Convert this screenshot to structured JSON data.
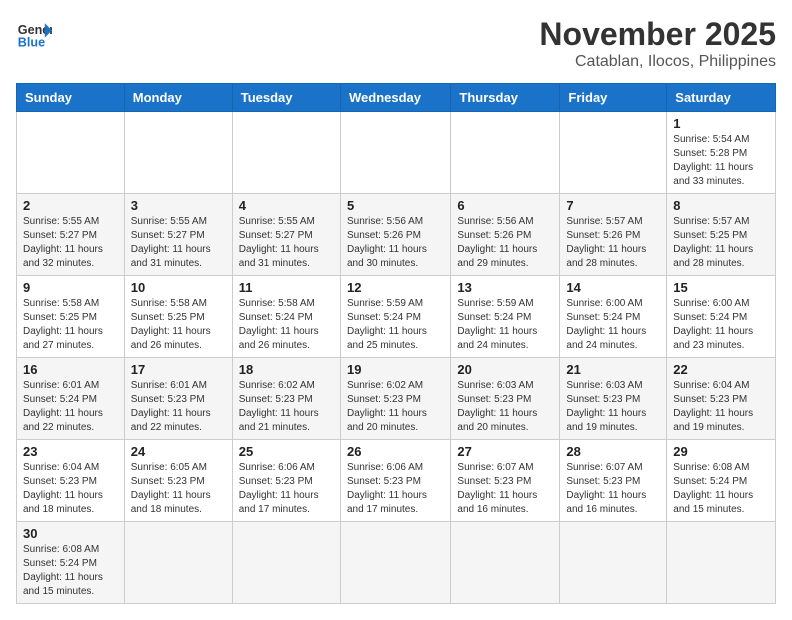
{
  "logo": {
    "text_general": "General",
    "text_blue": "Blue"
  },
  "header": {
    "month": "November 2025",
    "location": "Catablan, Ilocos, Philippines"
  },
  "weekdays": [
    "Sunday",
    "Monday",
    "Tuesday",
    "Wednesday",
    "Thursday",
    "Friday",
    "Saturday"
  ],
  "weeks": [
    [
      {
        "day": "",
        "sunrise": "",
        "sunset": "",
        "daylight": ""
      },
      {
        "day": "",
        "sunrise": "",
        "sunset": "",
        "daylight": ""
      },
      {
        "day": "",
        "sunrise": "",
        "sunset": "",
        "daylight": ""
      },
      {
        "day": "",
        "sunrise": "",
        "sunset": "",
        "daylight": ""
      },
      {
        "day": "",
        "sunrise": "",
        "sunset": "",
        "daylight": ""
      },
      {
        "day": "",
        "sunrise": "",
        "sunset": "",
        "daylight": ""
      },
      {
        "day": "1",
        "sunrise": "Sunrise: 5:54 AM",
        "sunset": "Sunset: 5:28 PM",
        "daylight": "Daylight: 11 hours and 33 minutes."
      }
    ],
    [
      {
        "day": "2",
        "sunrise": "Sunrise: 5:55 AM",
        "sunset": "Sunset: 5:27 PM",
        "daylight": "Daylight: 11 hours and 32 minutes."
      },
      {
        "day": "3",
        "sunrise": "Sunrise: 5:55 AM",
        "sunset": "Sunset: 5:27 PM",
        "daylight": "Daylight: 11 hours and 31 minutes."
      },
      {
        "day": "4",
        "sunrise": "Sunrise: 5:55 AM",
        "sunset": "Sunset: 5:27 PM",
        "daylight": "Daylight: 11 hours and 31 minutes."
      },
      {
        "day": "5",
        "sunrise": "Sunrise: 5:56 AM",
        "sunset": "Sunset: 5:26 PM",
        "daylight": "Daylight: 11 hours and 30 minutes."
      },
      {
        "day": "6",
        "sunrise": "Sunrise: 5:56 AM",
        "sunset": "Sunset: 5:26 PM",
        "daylight": "Daylight: 11 hours and 29 minutes."
      },
      {
        "day": "7",
        "sunrise": "Sunrise: 5:57 AM",
        "sunset": "Sunset: 5:26 PM",
        "daylight": "Daylight: 11 hours and 28 minutes."
      },
      {
        "day": "8",
        "sunrise": "Sunrise: 5:57 AM",
        "sunset": "Sunset: 5:25 PM",
        "daylight": "Daylight: 11 hours and 28 minutes."
      }
    ],
    [
      {
        "day": "9",
        "sunrise": "Sunrise: 5:58 AM",
        "sunset": "Sunset: 5:25 PM",
        "daylight": "Daylight: 11 hours and 27 minutes."
      },
      {
        "day": "10",
        "sunrise": "Sunrise: 5:58 AM",
        "sunset": "Sunset: 5:25 PM",
        "daylight": "Daylight: 11 hours and 26 minutes."
      },
      {
        "day": "11",
        "sunrise": "Sunrise: 5:58 AM",
        "sunset": "Sunset: 5:24 PM",
        "daylight": "Daylight: 11 hours and 26 minutes."
      },
      {
        "day": "12",
        "sunrise": "Sunrise: 5:59 AM",
        "sunset": "Sunset: 5:24 PM",
        "daylight": "Daylight: 11 hours and 25 minutes."
      },
      {
        "day": "13",
        "sunrise": "Sunrise: 5:59 AM",
        "sunset": "Sunset: 5:24 PM",
        "daylight": "Daylight: 11 hours and 24 minutes."
      },
      {
        "day": "14",
        "sunrise": "Sunrise: 6:00 AM",
        "sunset": "Sunset: 5:24 PM",
        "daylight": "Daylight: 11 hours and 24 minutes."
      },
      {
        "day": "15",
        "sunrise": "Sunrise: 6:00 AM",
        "sunset": "Sunset: 5:24 PM",
        "daylight": "Daylight: 11 hours and 23 minutes."
      }
    ],
    [
      {
        "day": "16",
        "sunrise": "Sunrise: 6:01 AM",
        "sunset": "Sunset: 5:24 PM",
        "daylight": "Daylight: 11 hours and 22 minutes."
      },
      {
        "day": "17",
        "sunrise": "Sunrise: 6:01 AM",
        "sunset": "Sunset: 5:23 PM",
        "daylight": "Daylight: 11 hours and 22 minutes."
      },
      {
        "day": "18",
        "sunrise": "Sunrise: 6:02 AM",
        "sunset": "Sunset: 5:23 PM",
        "daylight": "Daylight: 11 hours and 21 minutes."
      },
      {
        "day": "19",
        "sunrise": "Sunrise: 6:02 AM",
        "sunset": "Sunset: 5:23 PM",
        "daylight": "Daylight: 11 hours and 20 minutes."
      },
      {
        "day": "20",
        "sunrise": "Sunrise: 6:03 AM",
        "sunset": "Sunset: 5:23 PM",
        "daylight": "Daylight: 11 hours and 20 minutes."
      },
      {
        "day": "21",
        "sunrise": "Sunrise: 6:03 AM",
        "sunset": "Sunset: 5:23 PM",
        "daylight": "Daylight: 11 hours and 19 minutes."
      },
      {
        "day": "22",
        "sunrise": "Sunrise: 6:04 AM",
        "sunset": "Sunset: 5:23 PM",
        "daylight": "Daylight: 11 hours and 19 minutes."
      }
    ],
    [
      {
        "day": "23",
        "sunrise": "Sunrise: 6:04 AM",
        "sunset": "Sunset: 5:23 PM",
        "daylight": "Daylight: 11 hours and 18 minutes."
      },
      {
        "day": "24",
        "sunrise": "Sunrise: 6:05 AM",
        "sunset": "Sunset: 5:23 PM",
        "daylight": "Daylight: 11 hours and 18 minutes."
      },
      {
        "day": "25",
        "sunrise": "Sunrise: 6:06 AM",
        "sunset": "Sunset: 5:23 PM",
        "daylight": "Daylight: 11 hours and 17 minutes."
      },
      {
        "day": "26",
        "sunrise": "Sunrise: 6:06 AM",
        "sunset": "Sunset: 5:23 PM",
        "daylight": "Daylight: 11 hours and 17 minutes."
      },
      {
        "day": "27",
        "sunrise": "Sunrise: 6:07 AM",
        "sunset": "Sunset: 5:23 PM",
        "daylight": "Daylight: 11 hours and 16 minutes."
      },
      {
        "day": "28",
        "sunrise": "Sunrise: 6:07 AM",
        "sunset": "Sunset: 5:23 PM",
        "daylight": "Daylight: 11 hours and 16 minutes."
      },
      {
        "day": "29",
        "sunrise": "Sunrise: 6:08 AM",
        "sunset": "Sunset: 5:24 PM",
        "daylight": "Daylight: 11 hours and 15 minutes."
      }
    ],
    [
      {
        "day": "30",
        "sunrise": "Sunrise: 6:08 AM",
        "sunset": "Sunset: 5:24 PM",
        "daylight": "Daylight: 11 hours and 15 minutes."
      },
      {
        "day": "",
        "sunrise": "",
        "sunset": "",
        "daylight": ""
      },
      {
        "day": "",
        "sunrise": "",
        "sunset": "",
        "daylight": ""
      },
      {
        "day": "",
        "sunrise": "",
        "sunset": "",
        "daylight": ""
      },
      {
        "day": "",
        "sunrise": "",
        "sunset": "",
        "daylight": ""
      },
      {
        "day": "",
        "sunrise": "",
        "sunset": "",
        "daylight": ""
      },
      {
        "day": "",
        "sunrise": "",
        "sunset": "",
        "daylight": ""
      }
    ]
  ]
}
